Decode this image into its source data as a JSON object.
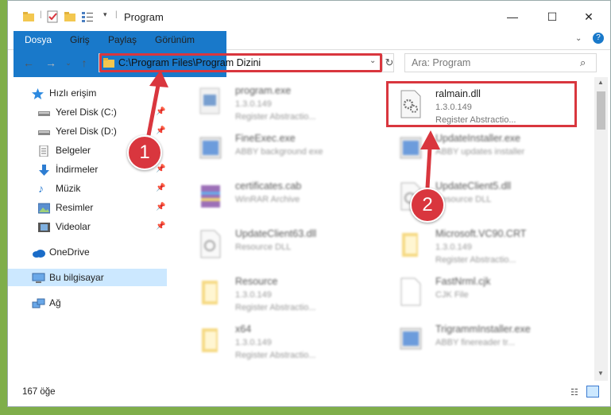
{
  "window": {
    "title": "Program",
    "minimize": "—",
    "maximize": "☐",
    "close": "✕"
  },
  "ribbon": {
    "tabs": [
      "Dosya",
      "Giriş",
      "Paylaş",
      "Görünüm"
    ]
  },
  "address": {
    "path": "C:\\Program Files\\Program Dizini",
    "search_placeholder": "Ara: Program"
  },
  "sidebar": {
    "items": [
      {
        "label": "Hızlı erişim",
        "icon": "star-icon"
      },
      {
        "label": "Yerel Disk (C:)",
        "icon": "drive-icon"
      },
      {
        "label": "Yerel Disk (D:)",
        "icon": "drive-icon"
      },
      {
        "label": "Belgeler",
        "icon": "documents-icon"
      },
      {
        "label": "İndirmeler",
        "icon": "download-icon"
      },
      {
        "label": "Müzik",
        "icon": "music-icon"
      },
      {
        "label": "Resimler",
        "icon": "pictures-icon"
      },
      {
        "label": "Videolar",
        "icon": "videos-icon"
      },
      {
        "label": "OneDrive",
        "icon": "cloud-icon"
      },
      {
        "label": "Bu bilgisayar",
        "icon": "computer-icon"
      },
      {
        "label": "Ağ",
        "icon": "network-icon"
      }
    ]
  },
  "files": [
    {
      "name": "program.exe",
      "line1": "1.3.0.149",
      "line2": "Register Abstractio..."
    },
    {
      "name": "ralmain.dll",
      "line1": "1.3.0.149",
      "line2": "Register Abstractio..."
    },
    {
      "name": "FineExec.exe",
      "line1": "ABBY background exe",
      "line2": ""
    },
    {
      "name": "UpdateInstaller.exe",
      "line1": "ABBY updates installer",
      "line2": ""
    },
    {
      "name": "certificates.cab",
      "line1": "WinRAR Archive",
      "line2": ""
    },
    {
      "name": "UpdateClient5.dll",
      "line1": "Resource DLL",
      "line2": ""
    },
    {
      "name": "UpdateClient63.dll",
      "line1": "Resource DLL",
      "line2": ""
    },
    {
      "name": "Microsoft.VC90.CRT",
      "line1": "1.3.0.149",
      "line2": "Register Abstractio..."
    },
    {
      "name": "Resource",
      "line1": "1.3.0.149",
      "line2": "Register Abstractio..."
    },
    {
      "name": "FastNrml.cjk",
      "line1": "CJK File",
      "line2": ""
    },
    {
      "name": "x64",
      "line1": "1.3.0.149",
      "line2": "Register Abstractio..."
    },
    {
      "name": "TrigrammInstaller.exe",
      "line1": "ABBY finereader tr...",
      "line2": ""
    }
  ],
  "status": {
    "count": "167 öğe"
  },
  "annotations": {
    "badge1": "1",
    "badge2": "2"
  },
  "colors": {
    "highlight": "#d9363e",
    "accent": "#1979ca",
    "selected": "#cce8ff"
  }
}
